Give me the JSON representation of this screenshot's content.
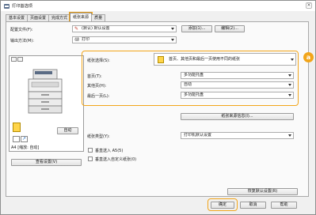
{
  "window": {
    "title": "打印首选项",
    "close": "×"
  },
  "tabs": [
    "基本设置",
    "页面设置",
    "完成方式",
    "纸张来源",
    "质量"
  ],
  "profile": {
    "label": "配置文件(F):",
    "value": "(默认) 默认设置",
    "add": "添加(1)...",
    "edit": "编辑(2)..."
  },
  "output": {
    "label": "输出方法(M):",
    "value": "打印"
  },
  "preview": {
    "auto_button": "自动",
    "status": "A4 [缩放: 自动]",
    "view_settings": "查看设置(V)"
  },
  "paper_select": {
    "label": "纸张选择(S):",
    "value": "首页、其他页和最后一页使用不同的纸张"
  },
  "first_page": {
    "label": "首页(T):",
    "value": "多功能托盘"
  },
  "other_pages": {
    "label": "其他页(H):",
    "value": "自动"
  },
  "last_page": {
    "label": "最后一页(L):",
    "value": "多功能托盘"
  },
  "paper_source_info": "纸张来源信息(I)...",
  "paper_type": {
    "label": "纸张类型(Y):",
    "value": "打印机默认设置"
  },
  "check_a5": "垂直送入 A5(5)",
  "check_custom": "垂直送入自定义纸张(0)",
  "restore_defaults": "恢复默认设置(R)",
  "buttons": {
    "ok": "确定",
    "cancel": "取消",
    "help": "帮助"
  },
  "badge": "a",
  "accent_color": "#f2a51a"
}
